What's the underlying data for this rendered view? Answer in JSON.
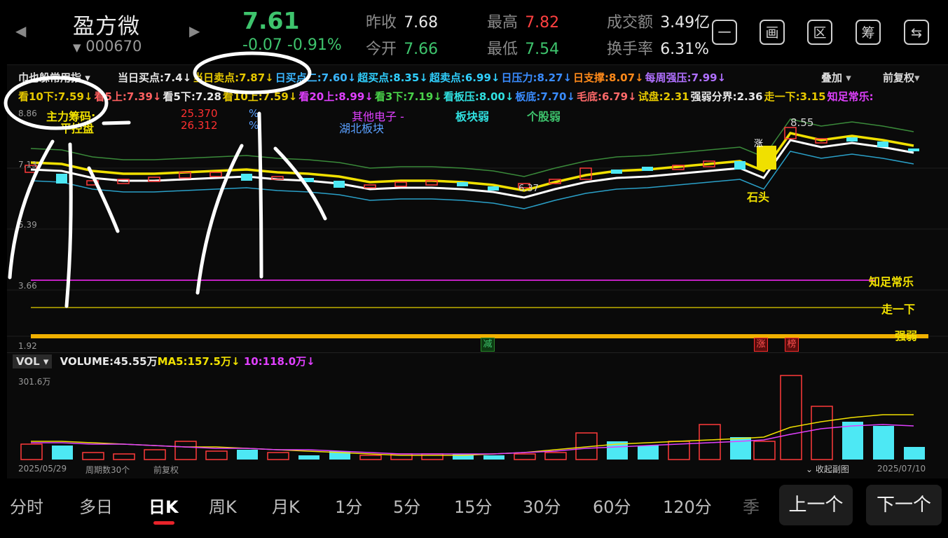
{
  "header": {
    "stock_name": "盈方微",
    "stock_code": "000670",
    "price": "7.61",
    "change": "-0.07  -0.91%",
    "quotes": [
      {
        "label": "昨收",
        "value": "7.68",
        "color": "#e8e8e8"
      },
      {
        "label": "今开",
        "value": "7.66",
        "color": "#3ec46d"
      },
      {
        "label": "最高",
        "value": "7.82",
        "color": "#ff4040"
      },
      {
        "label": "最低",
        "value": "7.54",
        "color": "#3ec46d"
      },
      {
        "label": "成交额",
        "value": "3.49亿",
        "color": "#e8e8e8"
      },
      {
        "label": "换手率",
        "value": "6.31%",
        "color": "#e8e8e8"
      }
    ],
    "tools": [
      "一",
      "画",
      "区",
      "筹",
      "⇆"
    ]
  },
  "indicators": {
    "dropdown": "巾也躲常用指",
    "overlay": "叠加",
    "adjust": "前复权",
    "row1": [
      {
        "t": "当日买点:7.4↓",
        "c": "#e8e8e8"
      },
      {
        "t": "当日卖点:7.87↓",
        "c": "#e6c800"
      },
      {
        "t": "日买点二:7.60↓",
        "c": "#3ab6ff"
      },
      {
        "t": "超买点:8.35↓",
        "c": "#30d0ff"
      },
      {
        "t": "超卖点:6.99↓",
        "c": "#30d0ff"
      },
      {
        "t": "日压力:8.27↓",
        "c": "#3a8cff"
      },
      {
        "t": "日支撑:8.07↓",
        "c": "#ff8a1a"
      },
      {
        "t": "每周强压:7.99↓",
        "c": "#b070ff"
      }
    ],
    "row2": [
      {
        "t": "看10下:7.59↓",
        "c": "#e6c800"
      },
      {
        "t": "看5上:7.39↓",
        "c": "#ff6060"
      },
      {
        "t": "看5下:7.28",
        "c": "#e8e8e8"
      },
      {
        "t": "看10上:7.59↓",
        "c": "#e6c800"
      },
      {
        "t": "看20上:8.99↓",
        "c": "#e040ff"
      },
      {
        "t": "看3下:7.19↓",
        "c": "#4ad24a"
      },
      {
        "t": "看板压:8.00↓",
        "c": "#30e0e0"
      },
      {
        "t": "板底:7.70↓",
        "c": "#3a8cff"
      },
      {
        "t": "毛底:6.79↓",
        "c": "#ff6a6a"
      },
      {
        "t": "试盘:2.31",
        "c": "#e6c800"
      },
      {
        "t": "强弱分界:2.36",
        "c": "#e8e8e8"
      },
      {
        "t": "走一下:3.15",
        "c": "#e6c800"
      },
      {
        "t": "知足常乐:",
        "c": "#e040ff"
      }
    ]
  },
  "main_chart": {
    "yaxis": [
      "8.86",
      "7.13",
      "5.39",
      "3.66",
      "1.92"
    ],
    "label_chip": "主力筹码:",
    "label_chip2": "平控盘",
    "pct1": "25.370",
    "pct2": "26.312",
    "pct_sign": "%",
    "sector1": "其他电子 -",
    "sector2": "湖北板块",
    "weak1": "板块弱",
    "weak2": "个股弱",
    "peak_label": "8.55",
    "low_label": "6.37",
    "zhang_tag": "涨",
    "stone": "石头",
    "line_zhizu": "知足常乐",
    "line_zouyixia": "走一下",
    "line_qiangruo": "强弱",
    "tag_jian": "减",
    "tag_zhang": "涨",
    "tag_bang": "榜"
  },
  "volume": {
    "selector": "VOL",
    "volume": "VOLUME:45.55万",
    "ma5": "MA5:157.5万↓",
    "ma10": "10:118.0万↓",
    "ymax": "301.6万",
    "date_start": "2025/05/29",
    "period": "周期数30个",
    "adjust": "前复权",
    "collapse": "收起副图",
    "date_end": "2025/07/10"
  },
  "tabs": [
    "分时",
    "多日",
    "日K",
    "周K",
    "月K",
    "1分",
    "5分",
    "15分",
    "30分",
    "60分",
    "120分",
    "季"
  ],
  "active_tab": "日K",
  "prev_btn": "上一个",
  "next_btn": "下一个",
  "colors": {
    "up": "#ff3b3b",
    "down": "#4de8f4",
    "yellow": "#f0e000",
    "green": "#3ec46d"
  }
}
